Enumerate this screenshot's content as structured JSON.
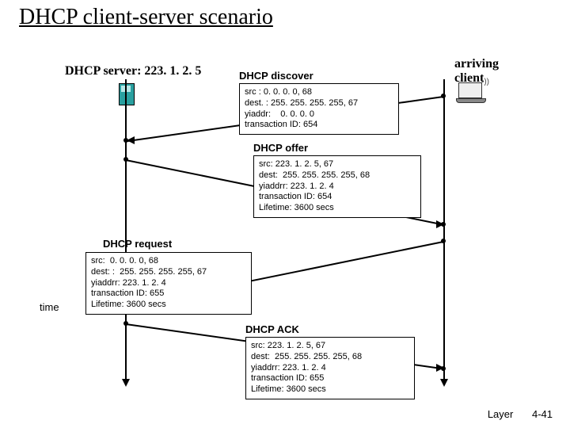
{
  "title": "DHCP client-server scenario",
  "server_label": "DHCP server: 223. 1. 2. 5",
  "client_label": "arriving\nclient",
  "time_label": "time",
  "footer": {
    "layer": "Layer",
    "slide": "4-41"
  },
  "discover": {
    "title": "DHCP discover",
    "body": "src : 0. 0. 0. 0, 68\ndest. : 255. 255. 255. 255, 67\nyiaddr:    0. 0. 0. 0\ntransaction ID: 654"
  },
  "offer": {
    "title": "DHCP offer",
    "body": "src: 223. 1. 2. 5, 67\ndest:  255. 255. 255. 255, 68\nyiaddrr: 223. 1. 2. 4\ntransaction ID: 654\nLifetime: 3600 secs"
  },
  "request": {
    "title": "DHCP request",
    "body": "src:  0. 0. 0. 0, 68\ndest: :  255. 255. 255. 255, 67\nyiaddrr: 223. 1. 2. 4\ntransaction ID: 655\nLifetime: 3600 secs"
  },
  "ack": {
    "title": "DHCP ACK",
    "body": "src: 223. 1. 2. 5, 67\ndest:  255. 255. 255. 255, 68\nyiaddrr: 223. 1. 2. 4\ntransaction ID: 655\nLifetime: 3600 secs"
  }
}
